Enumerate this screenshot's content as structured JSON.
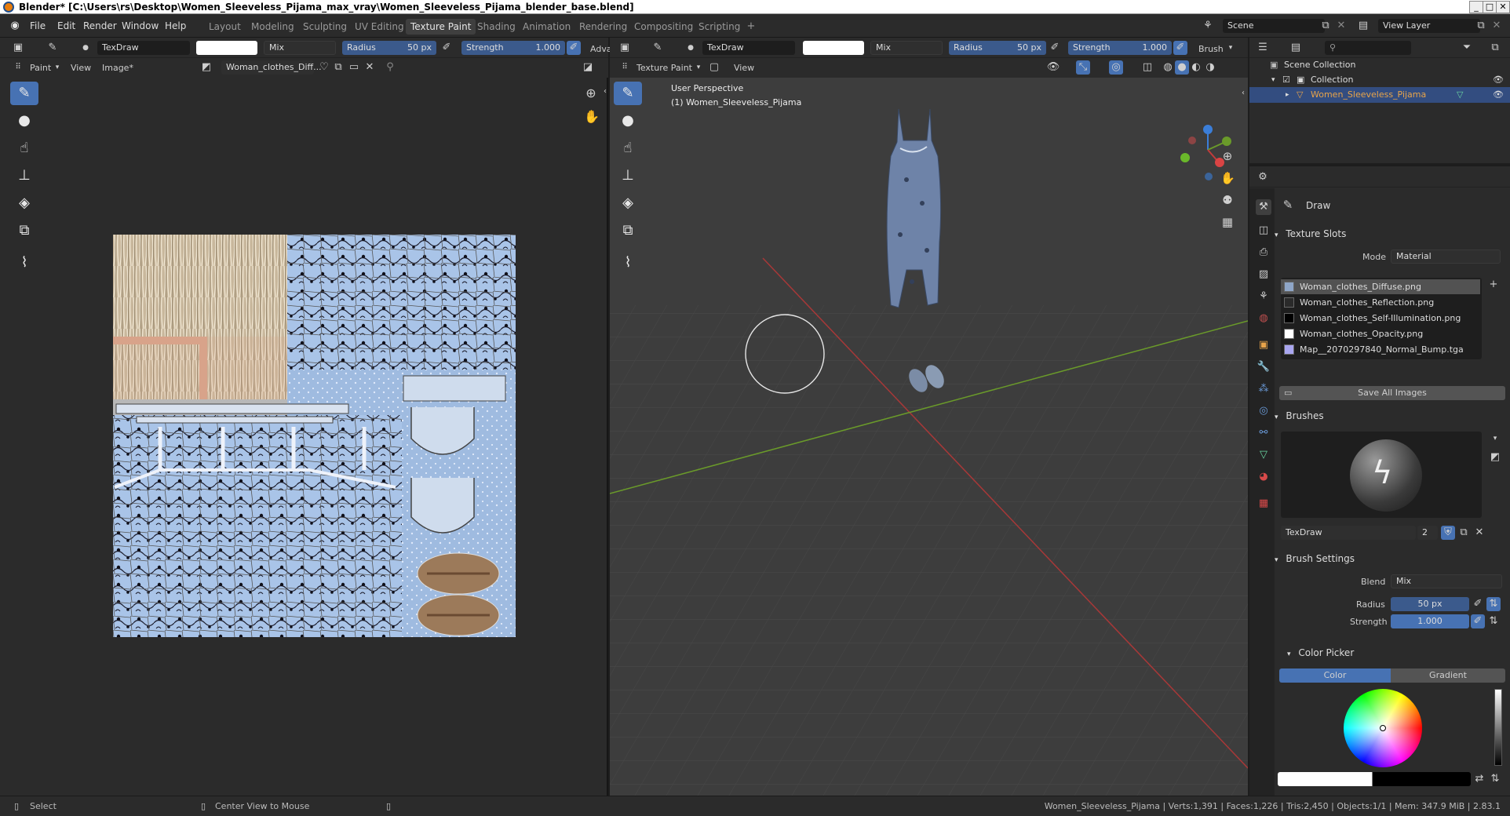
{
  "window": {
    "title": "Blender* [C:\\Users\\rs\\Desktop\\Women_Sleeveless_Pijama_max_vray\\Women_Sleeveless_Pijama_blender_base.blend]",
    "buttons": [
      "_",
      "□",
      "✕"
    ]
  },
  "menu": [
    "File",
    "Edit",
    "Render",
    "Window",
    "Help"
  ],
  "workspaces": [
    "Layout",
    "Modeling",
    "Sculpting",
    "UV Editing",
    "Texture Paint",
    "Shading",
    "Animation",
    "Rendering",
    "Compositing",
    "Scripting"
  ],
  "active_workspace": "Texture Paint",
  "scene": {
    "name": "Scene",
    "view_layer": "View Layer"
  },
  "image_editor": {
    "brush": "TexDraw",
    "blend": "Mix",
    "radius_label": "Radius",
    "radius_value": "50 px",
    "strength_label": "Strength",
    "strength_value": "1.000",
    "adv_label": "Adva",
    "mode": "Paint",
    "view_menu": "View",
    "image_menu": "Image*",
    "image_name": "Woman_clothes_Diff..."
  },
  "viewport": {
    "brush": "TexDraw",
    "blend": "Mix",
    "radius_label": "Radius",
    "radius_value": "50 px",
    "strength_label": "Strength",
    "strength_value": "1.000",
    "brush_menu": "Brush",
    "mode": "Texture Paint",
    "view_menu": "View",
    "perspective": "User Perspective",
    "object_info": "(1) Women_Sleeveless_Pijama"
  },
  "outliner": {
    "scene_collection": "Scene Collection",
    "collection": "Collection",
    "object": "Women_Sleeveless_Pijama"
  },
  "properties": {
    "tool_name": "Draw",
    "texture_slots_header": "Texture Slots",
    "mode_label": "Mode",
    "mode_value": "Material",
    "slots": [
      {
        "name": "Woman_clothes_Diffuse.png",
        "color": "#8fa6c8",
        "selected": true
      },
      {
        "name": "Woman_clothes_Reflection.png",
        "color": "#2a2a2a",
        "selected": false
      },
      {
        "name": "Woman_clothes_Self-Illumination.png",
        "color": "#000000",
        "selected": false
      },
      {
        "name": "Woman_clothes_Opacity.png",
        "color": "#ffffff",
        "selected": false
      },
      {
        "name": "Map__2070297840_Normal_Bump.tga",
        "color": "#a9a6f0",
        "selected": false
      }
    ],
    "save_all": "Save All Images",
    "brushes_header": "Brushes",
    "brush_name": "TexDraw",
    "brush_users": "2",
    "brush_settings_header": "Brush Settings",
    "blend_label": "Blend",
    "blend_value": "Mix",
    "radius_label": "Radius",
    "radius_value": "50 px",
    "strength_label": "Strength",
    "strength_value": "1.000",
    "color_picker_header": "Color Picker",
    "color_tab": "Color",
    "gradient_tab": "Gradient"
  },
  "statusbar": {
    "select": "Select",
    "center": "Center View to Mouse",
    "stats": "Women_Sleeveless_Pijama | Verts:1,391 | Faces:1,226 | Tris:2,450 | Objects:1/1 | Mem: 347.9 MiB | 2.83.1"
  },
  "colors": {
    "accent": "#4772b3",
    "axis_x": "#a83838",
    "axis_y": "#6a9a2a",
    "object_selected": "#e8a44a"
  }
}
